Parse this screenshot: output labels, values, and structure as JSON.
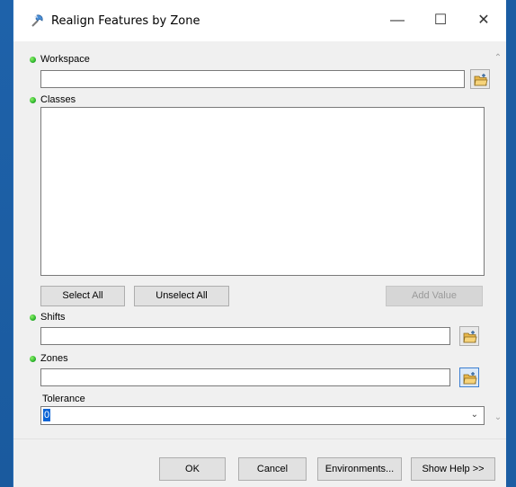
{
  "window": {
    "title": "Realign Features by Zone",
    "minimize_glyph": "—",
    "maximize_glyph": "☐",
    "close_glyph": "✕"
  },
  "form": {
    "workspace": {
      "label": "Workspace",
      "value": "",
      "required": true
    },
    "classes": {
      "label": "Classes",
      "required": true
    },
    "list_buttons": {
      "select_all": "Select All",
      "unselect_all": "Unselect All",
      "add_value": "Add Value"
    },
    "shifts": {
      "label": "Shifts",
      "value": "",
      "required": true
    },
    "zones": {
      "label": "Zones",
      "value": "",
      "required": true
    },
    "tolerance": {
      "label": "Tolerance",
      "value": "0"
    }
  },
  "footer": {
    "ok": "OK",
    "cancel": "Cancel",
    "environments": "Environments...",
    "show_help": "Show Help >>"
  },
  "colors": {
    "required_dot": "#2eb82e",
    "selection": "#0a64d6",
    "desktop": "#1c5fa5"
  }
}
